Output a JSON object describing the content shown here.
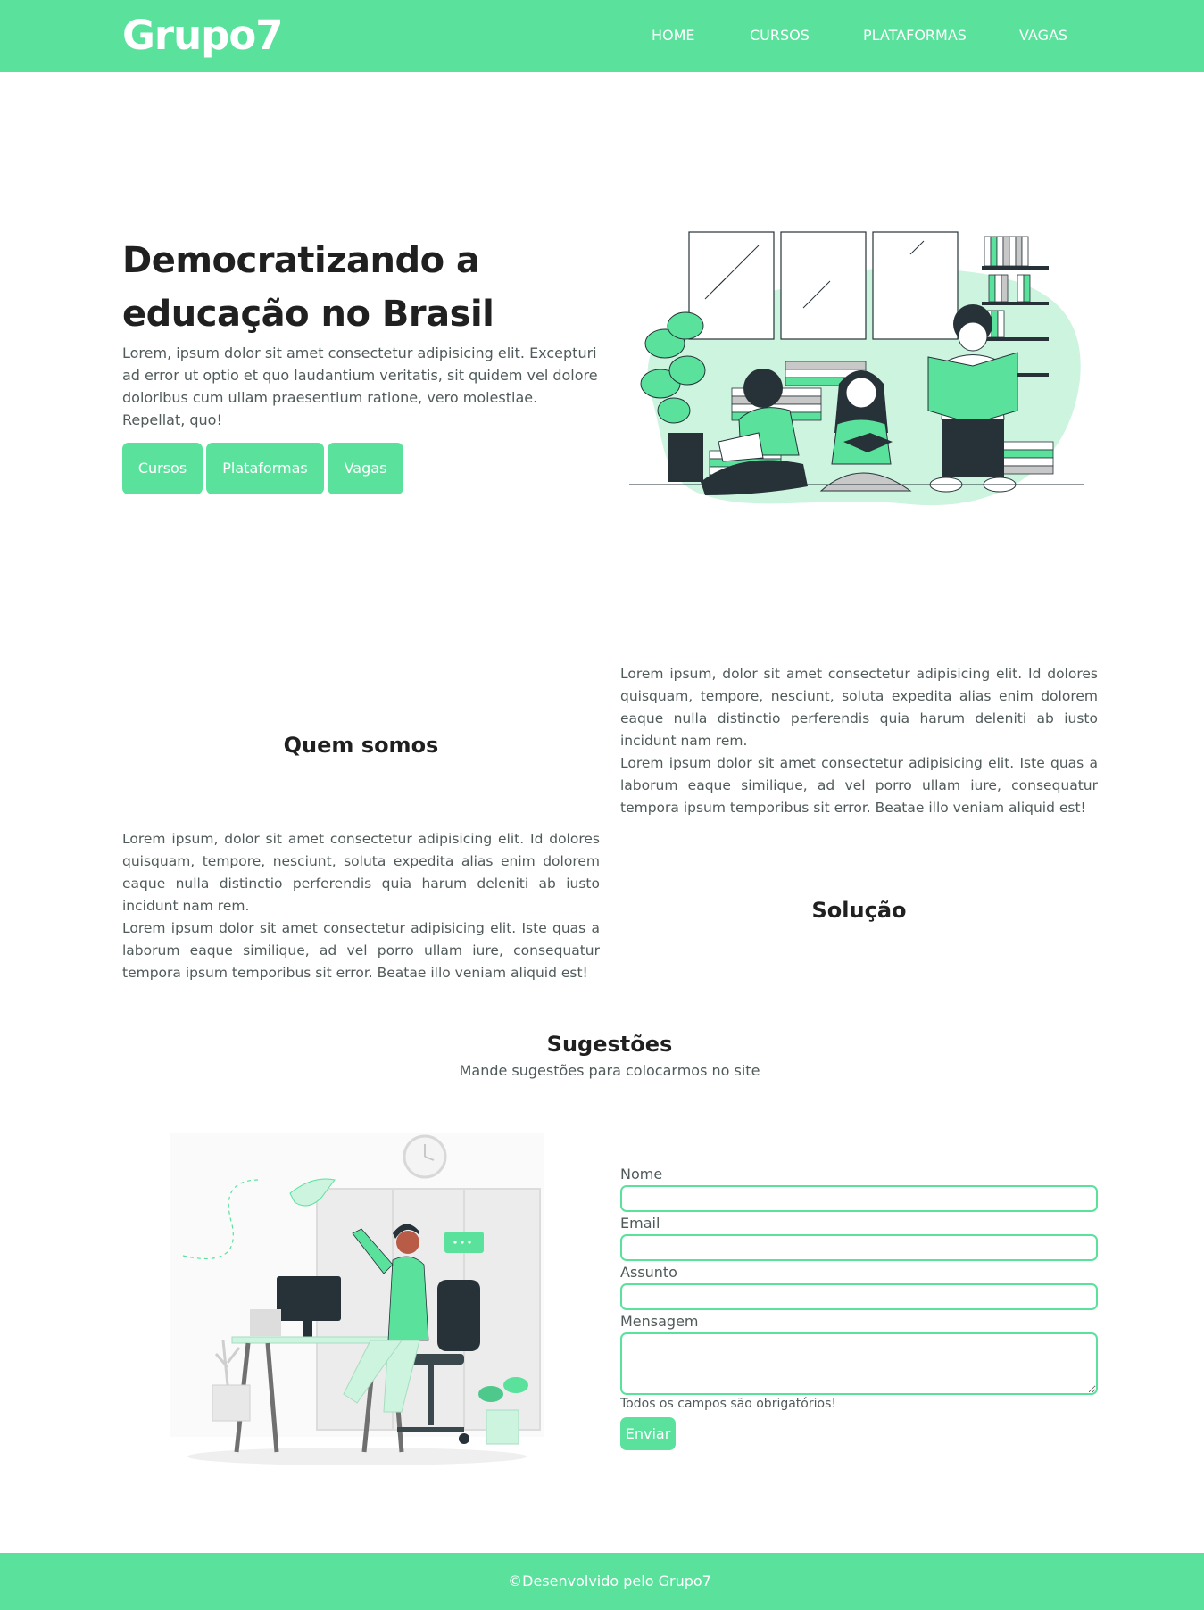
{
  "header": {
    "brand": "Grupo7",
    "nav": {
      "home": "HOME",
      "cursos": "CURSOS",
      "plataformas": "PLATAFORMAS",
      "vagas": "VAGAS"
    }
  },
  "hero": {
    "title": "Democratizando a educação no Brasil",
    "text": "Lorem, ipsum dolor sit amet consectetur adipisicing elit. Excepturi ad error ut optio et quo laudantium veritatis, sit quidem vel dolore doloribus cum ullam praesentium ratione, vero molestiae. Repellat, quo!",
    "buttons": {
      "cursos": "Cursos",
      "plataformas": "Plataformas",
      "vagas": "Vagas"
    }
  },
  "about": {
    "quem_title": "Quem somos",
    "solucao_title": "Solução",
    "paragraph_1": "Lorem ipsum, dolor sit amet consectetur adipisicing elit. Id dolores quisquam, tempore, nesciunt, soluta expedita alias enim dolorem eaque nulla distinctio perferendis quia harum deleniti ab iusto incidunt nam rem.",
    "paragraph_2": "Lorem ipsum dolor sit amet consectetur adipisicing elit. Iste quas a laborum eaque similique, ad vel porro ullam iure, consequatur tempora ipsum temporibus sit error. Beatae illo veniam aliquid est!"
  },
  "suggestions": {
    "title": "Sugestões",
    "subtitle": "Mande sugestões para colocarmos no site",
    "form": {
      "nome_label": "Nome",
      "email_label": "Email",
      "assunto_label": "Assunto",
      "mensagem_label": "Mensagem",
      "nome_value": "",
      "email_value": "",
      "assunto_value": "",
      "mensagem_value": "",
      "note": "Todos os campos são obrigatórios!",
      "submit": "Enviar"
    }
  },
  "footer": {
    "text": "©Desenvolvido pelo Grupo7"
  },
  "colors": {
    "accent": "#5ae29d",
    "accent_light": "#cdf4df",
    "dark": "#263238",
    "text": "#505a5a"
  }
}
